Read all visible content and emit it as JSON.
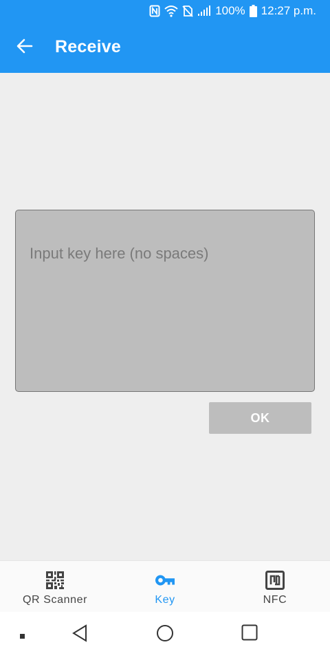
{
  "status_bar": {
    "battery": "100%",
    "time": "12:27 p.m.",
    "icons": [
      "nfc-icon",
      "wifi-icon",
      "no-sim-icon",
      "signal-icon",
      "battery-icon"
    ]
  },
  "app_bar": {
    "title": "Receive",
    "back_icon": "arrow-left-icon"
  },
  "key_input": {
    "placeholder": "Input key here (no spaces)",
    "value": ""
  },
  "ok_button": {
    "label": "OK"
  },
  "bottom_nav": {
    "items": [
      {
        "label": "QR Scanner",
        "icon": "qr-code-icon",
        "active": false
      },
      {
        "label": "Key",
        "icon": "key-icon",
        "active": true
      },
      {
        "label": "NFC",
        "icon": "nfc-icon",
        "active": false
      }
    ]
  },
  "system_nav": {
    "buttons": [
      "recent-dot-icon",
      "back-triangle-icon",
      "home-circle-icon",
      "overview-square-icon"
    ]
  },
  "colors": {
    "primary": "#2196f3",
    "background": "#eeeeee",
    "input_bg": "#bdbdbd",
    "disabled_button": "#bdbdbd"
  }
}
